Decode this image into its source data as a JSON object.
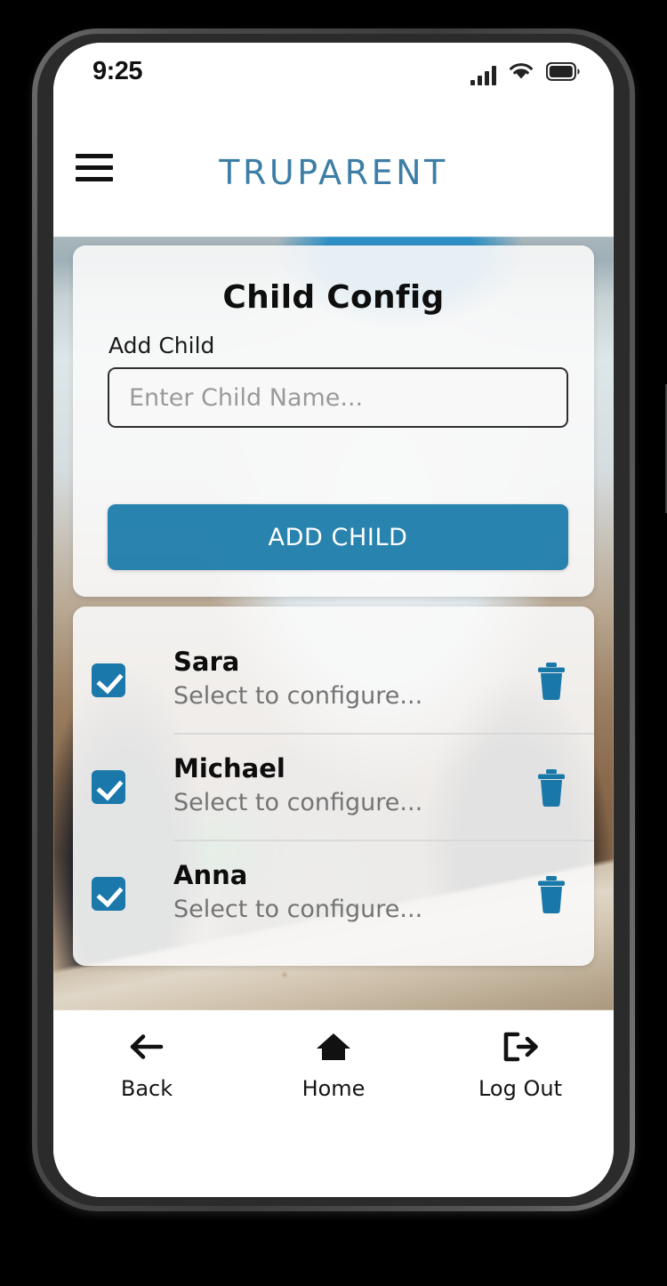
{
  "status_bar": {
    "time": "9:25",
    "icons": [
      "signal-bars-icon",
      "wifi-icon",
      "battery-icon"
    ]
  },
  "header": {
    "menu_icon": "hamburger-menu-icon",
    "brand": "TRUPARENT",
    "brand_color": "#3d7ea6"
  },
  "config_card": {
    "title": "Child Config",
    "add_child_label": "Add Child",
    "input_placeholder": "Enter Child Name...",
    "input_value": "",
    "add_button_label": "ADD CHILD",
    "button_color": "#1778a8"
  },
  "children_card": {
    "rows": [
      {
        "name": "Sara",
        "subtitle": "Select to configure...",
        "checked": true,
        "delete_icon": "trash-icon"
      },
      {
        "name": "Michael",
        "subtitle": "Select to configure...",
        "checked": true,
        "delete_icon": "trash-icon"
      },
      {
        "name": "Anna",
        "subtitle": "Select to configure...",
        "checked": true,
        "delete_icon": "trash-icon"
      }
    ],
    "checkbox_color": "#1b78ab",
    "trash_color": "#1a78a9"
  },
  "bottom_nav": {
    "items": [
      {
        "label": "Back",
        "icon": "arrow-left-icon"
      },
      {
        "label": "Home",
        "icon": "home-icon"
      },
      {
        "label": "Log Out",
        "icon": "logout-icon"
      }
    ]
  }
}
